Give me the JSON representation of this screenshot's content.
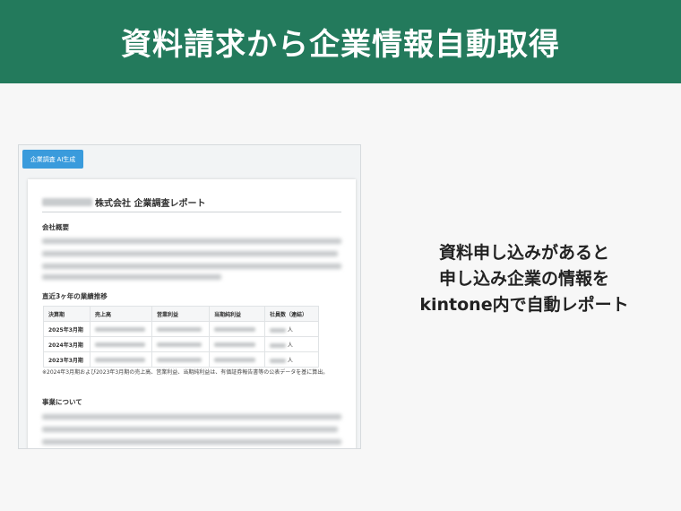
{
  "banner": {
    "title": "資料請求から企業情報自動取得"
  },
  "screenshot": {
    "ai_button_label": "企業調査 AI生成",
    "report_title": "株式会社 企業調査レポート",
    "section_overview": "会社概要",
    "section_performance": "直近3ヶ年の業績推移",
    "table": {
      "headers": [
        "決算期",
        "売上高",
        "営業利益",
        "当期純利益",
        "社員数（連結）"
      ],
      "rows": [
        {
          "period": "2025年3月期",
          "unit": "人"
        },
        {
          "period": "2024年3月期",
          "unit": "人"
        },
        {
          "period": "2023年3月期",
          "unit": "人"
        }
      ]
    },
    "footnote": "※2024年3月期および2023年3月期の売上高、営業利益、当期純利益は、有価証券報告書等の公表データを基に算出。",
    "section_business": "事業について"
  },
  "caption": {
    "line1": "資料申し込みがあると",
    "line2": "申し込み企業の情報を",
    "line3": "kintone内で自動レポート"
  },
  "colors": {
    "banner": "#237a5c",
    "button": "#3a9bdc"
  }
}
